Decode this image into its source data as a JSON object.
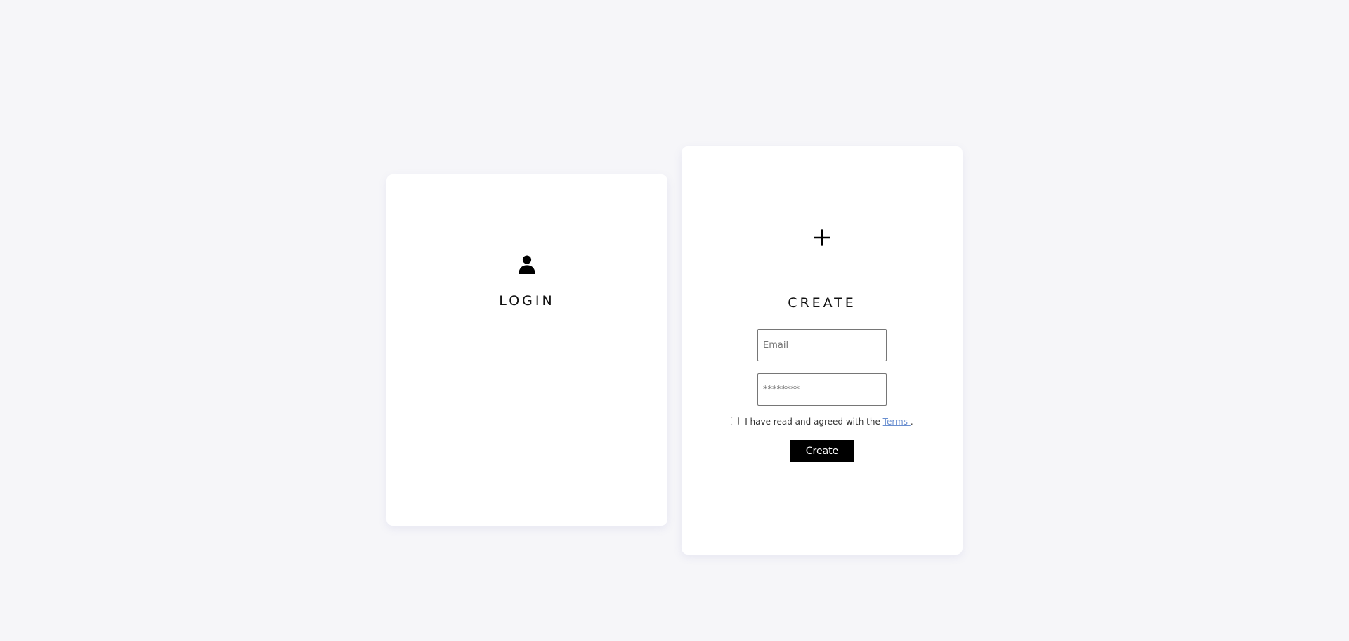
{
  "login_card": {
    "icon": "user-icon",
    "title": "LOGIN"
  },
  "create_card": {
    "icon": "plus-icon",
    "title": "CREATE",
    "email_placeholder": "Email",
    "password_placeholder": "********",
    "terms_prefix": "I have read and agreed with the ",
    "terms_link": "Terms ",
    "terms_suffix": ".",
    "create_button_label": "Create"
  }
}
